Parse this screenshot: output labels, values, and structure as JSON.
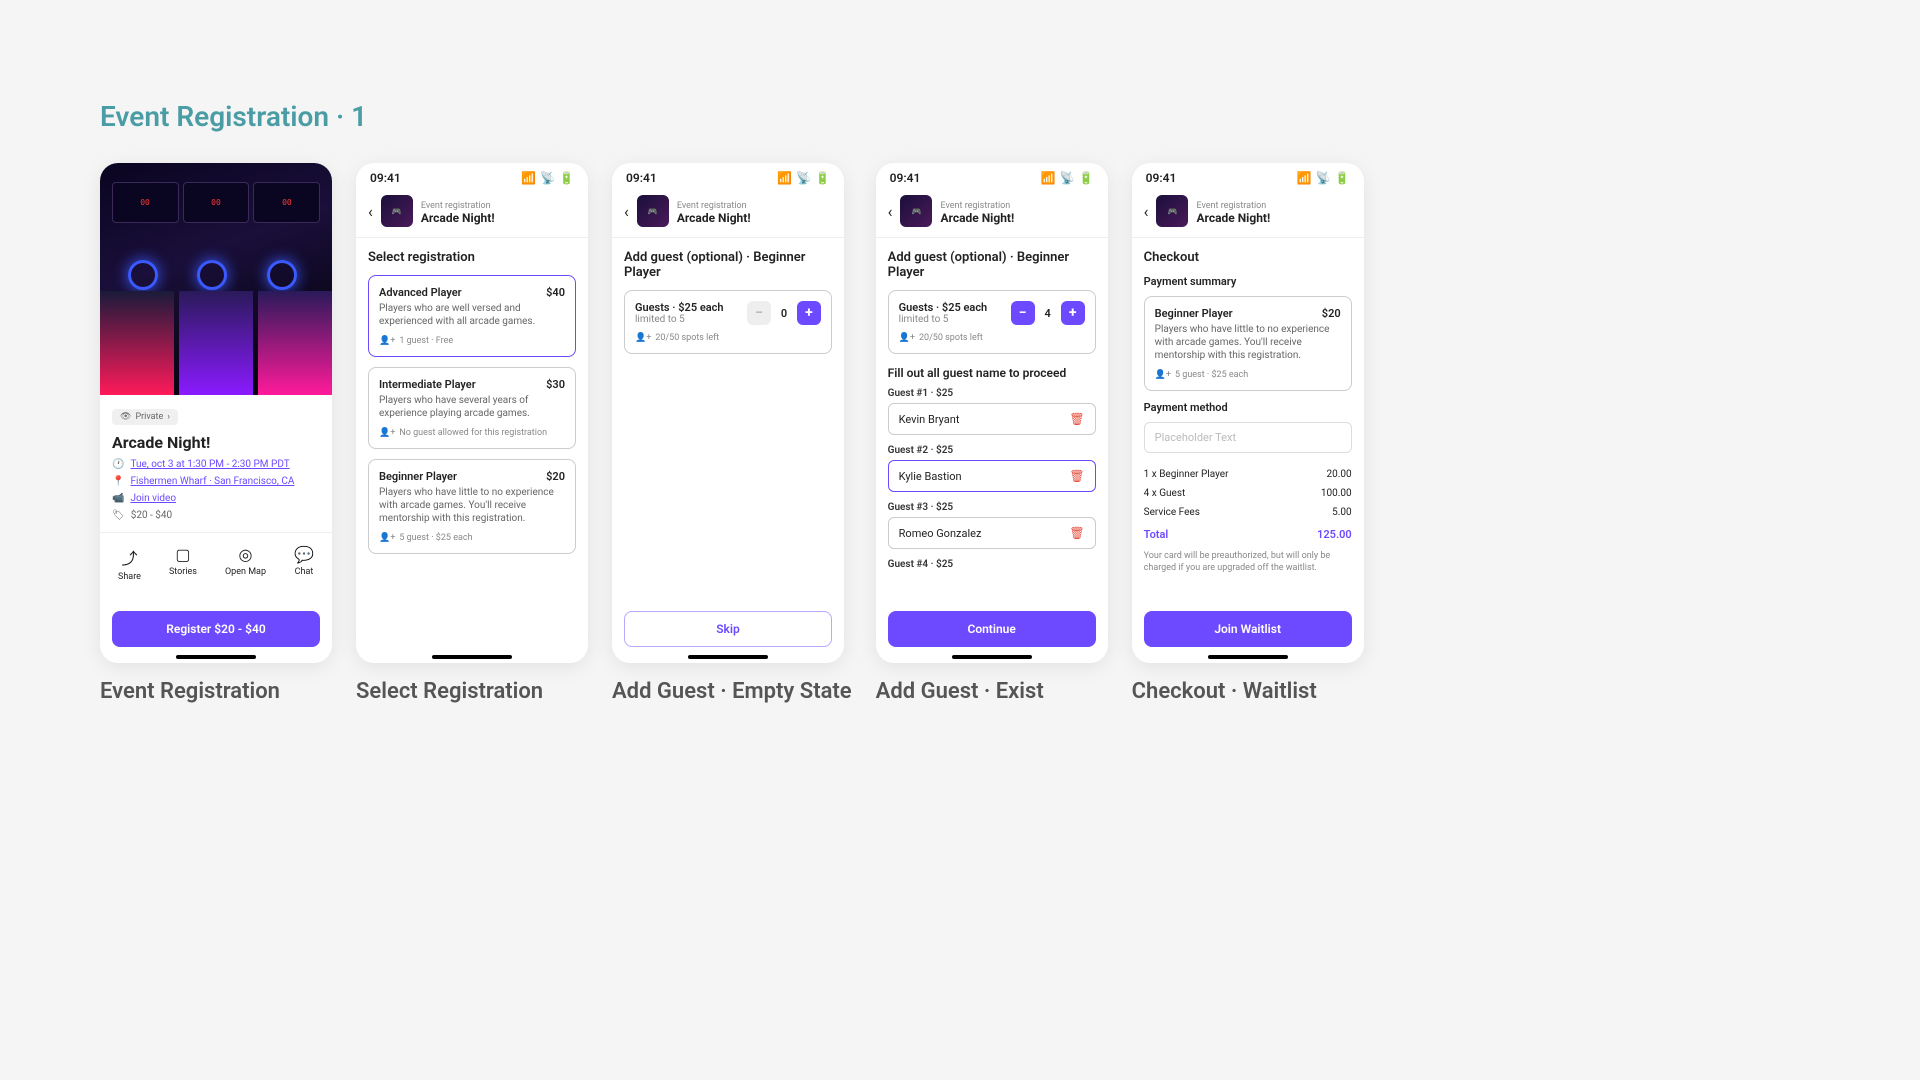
{
  "pageTitle": "Event Registration · 1",
  "statusTime": "09:41",
  "header": {
    "breadcrumb": "Event registration",
    "title": "Arcade Night!"
  },
  "screen1": {
    "label": "Event Registration",
    "privacyBadge": "Private",
    "eventTitle": "Arcade Night!",
    "datetime": "Tue, oct 3 at 1:30 PM - 2:30 PM PDT",
    "location": "Fishermen Wharf · San Francisco, CA",
    "videoLink": "Join video",
    "priceRange": "$20 - $40",
    "actions": {
      "share": "Share",
      "stories": "Stories",
      "openMap": "Open Map",
      "chat": "Chat"
    },
    "cta": "Register $20 - $40"
  },
  "screen2": {
    "label": "Select Registration",
    "heading": "Select registration",
    "options": [
      {
        "name": "Advanced Player",
        "price": "$40",
        "desc": "Players who are well versed and experienced with all arcade games.",
        "meta": "1 guest · Free"
      },
      {
        "name": "Intermediate Player",
        "price": "$30",
        "desc": "Players who have several years of experience playing arcade games.",
        "meta": "No guest allowed for this registration"
      },
      {
        "name": "Beginner Player",
        "price": "$20",
        "desc": "Players who have little to no experience with arcade games. You'll receive mentorship with this registration.",
        "meta": "5 guest · $25 each"
      }
    ]
  },
  "screen3": {
    "label": "Add Guest · Empty State",
    "heading": "Add guest (optional) · Beginner Player",
    "guestPrice": "Guests · $25 each",
    "limit": "limited to 5",
    "spots": "20/50 spots left",
    "qty": "0",
    "cta": "Skip"
  },
  "screen4": {
    "label": "Add Guest · Exist",
    "heading": "Add guest (optional) · Beginner Player",
    "guestPrice": "Guests · $25 each",
    "limit": "limited to 5",
    "spots": "20/50 spots left",
    "qty": "4",
    "instruction": "Fill out all guest name to proceed",
    "guests": [
      {
        "label": "Guest #1 · $25",
        "name": "Kevin Bryant"
      },
      {
        "label": "Guest #2 · $25",
        "name": "Kylie Bastion"
      },
      {
        "label": "Guest #3 · $25",
        "name": "Romeo Gonzalez"
      },
      {
        "label": "Guest #4 · $25",
        "name": ""
      }
    ],
    "cta": "Continue"
  },
  "screen5": {
    "label": "Checkout · Waitlist",
    "heading": "Checkout",
    "summaryHeading": "Payment summary",
    "item": {
      "name": "Beginner Player",
      "price": "$20",
      "desc": "Players who have little to no experience with arcade games. You'll receive mentorship with this registration.",
      "meta": "5 guest · $25 each"
    },
    "methodHeading": "Payment method",
    "placeholder": "Placeholder Text",
    "lines": [
      {
        "label": "1 x Beginner Player",
        "value": "20.00"
      },
      {
        "label": "4 x Guest",
        "value": "100.00"
      },
      {
        "label": "Service Fees",
        "value": "5.00"
      }
    ],
    "totalLabel": "Total",
    "totalValue": "125.00",
    "finePrint": "Your card will be preauthorized, but will only be charged if you are upgraded off the waitlist.",
    "cta": "Join Waitlist"
  }
}
